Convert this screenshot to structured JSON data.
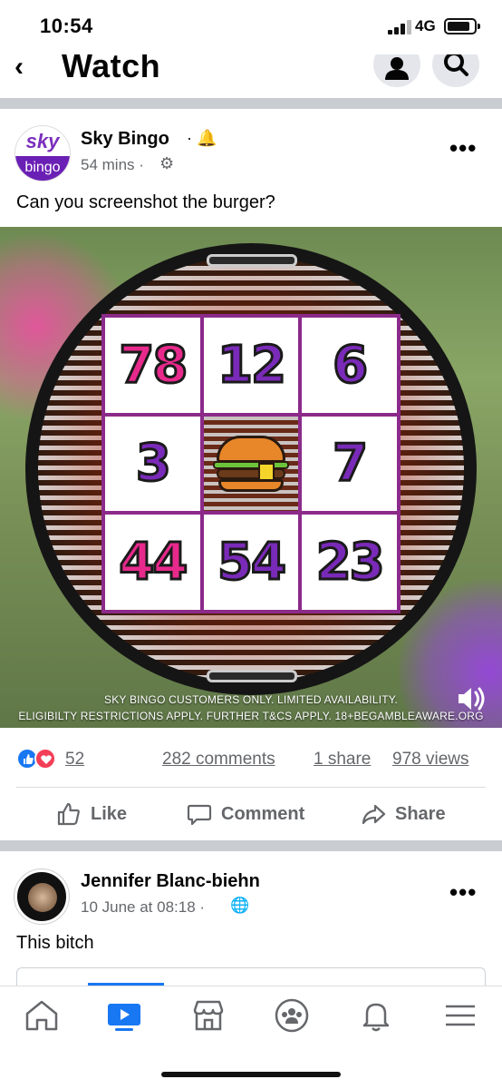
{
  "status_bar": {
    "time": "10:54",
    "network": "4G"
  },
  "header": {
    "title": "Watch"
  },
  "post": {
    "logo_top": "sky",
    "logo_bottom": "bingo",
    "page_name": "Sky Bingo",
    "time": "54 mins",
    "text": "Can you screenshot the burger?",
    "bingo_numbers": [
      "78",
      "12",
      "6",
      "3",
      "",
      "7",
      "44",
      "54",
      "23"
    ],
    "disclaimer_line1": "SKY BINGO CUSTOMERS ONLY. LIMITED AVAILABILITY.",
    "disclaimer_line2": "ELIGIBILTY RESTRICTIONS APPLY. FURTHER T&CS APPLY. 18+BEGAMBLEAWARE.ORG",
    "reactions_count": "52",
    "comments": "282 comments",
    "shares": "1 share",
    "views": "978 views"
  },
  "actions": {
    "like": "Like",
    "comment": "Comment",
    "share": "Share"
  },
  "post2": {
    "author": "Jennifer Blanc-biehn",
    "time": "10 June at 08:18",
    "text": "This bitch"
  },
  "colors": {
    "accent": "#1877f2",
    "love": "#f33e58",
    "divider": "#c9ccd1",
    "bingo_pink": "#e8298c",
    "bingo_purple": "#7a2ab8"
  },
  "icons": [
    "back-icon",
    "profile-icon",
    "search-icon",
    "bell-icon",
    "gear-icon",
    "more-icon",
    "sound-icon",
    "like-icon",
    "comment-icon",
    "share-icon",
    "globe-icon",
    "home-icon",
    "watch-icon",
    "marketplace-icon",
    "groups-icon",
    "notifications-icon",
    "menu-icon"
  ]
}
